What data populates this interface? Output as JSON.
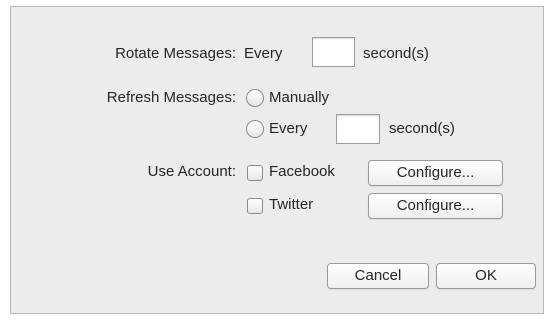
{
  "rotate": {
    "label": "Rotate Messages:",
    "every_label": "Every",
    "seconds_value": "",
    "unit_label": "second(s)"
  },
  "refresh": {
    "label": "Refresh Messages:",
    "option_manual": "Manually",
    "option_every": "Every",
    "seconds_value": "",
    "unit_label": "second(s)",
    "selected": "none"
  },
  "accounts": {
    "label": "Use Account:",
    "items": [
      {
        "name": "Facebook",
        "checked": false,
        "configure_label": "Configure..."
      },
      {
        "name": "Twitter",
        "checked": false,
        "configure_label": "Configure..."
      }
    ]
  },
  "buttons": {
    "cancel": "Cancel",
    "ok": "OK"
  }
}
